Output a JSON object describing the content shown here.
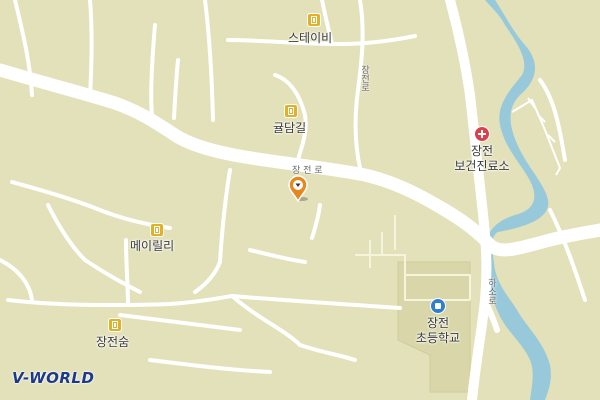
{
  "map": {
    "colors": {
      "land": "#e3e1b9",
      "road": "#ffffff",
      "water": "#98c9db",
      "school_area": "#d9d7a9",
      "pin": "#e8871e"
    },
    "places": [
      {
        "id": "stayvi",
        "name": "스테이비",
        "type": "lodging"
      },
      {
        "id": "gyuldamgil",
        "name": "귤담길",
        "type": "lodging"
      },
      {
        "id": "meirilli",
        "name": "메이릴리",
        "type": "lodging"
      },
      {
        "id": "jangjeonsum",
        "name": "장전숨",
        "type": "lodging"
      },
      {
        "id": "clinic",
        "name_line1": "장전",
        "name_line2": "보건진료소",
        "type": "clinic"
      },
      {
        "id": "school",
        "name_line1": "장전",
        "name_line2": "초등학교",
        "type": "school"
      }
    ],
    "roads": [
      {
        "id": "jangjeon-ro-h",
        "name": "장 전 로"
      },
      {
        "id": "jangjeon-ro-v",
        "name": "장전로"
      },
      {
        "id": "hasoro",
        "name": "하소로"
      }
    ],
    "marker": {
      "name": "selected-location-pin"
    },
    "brand": {
      "logo_text": "V-WORLD"
    }
  }
}
